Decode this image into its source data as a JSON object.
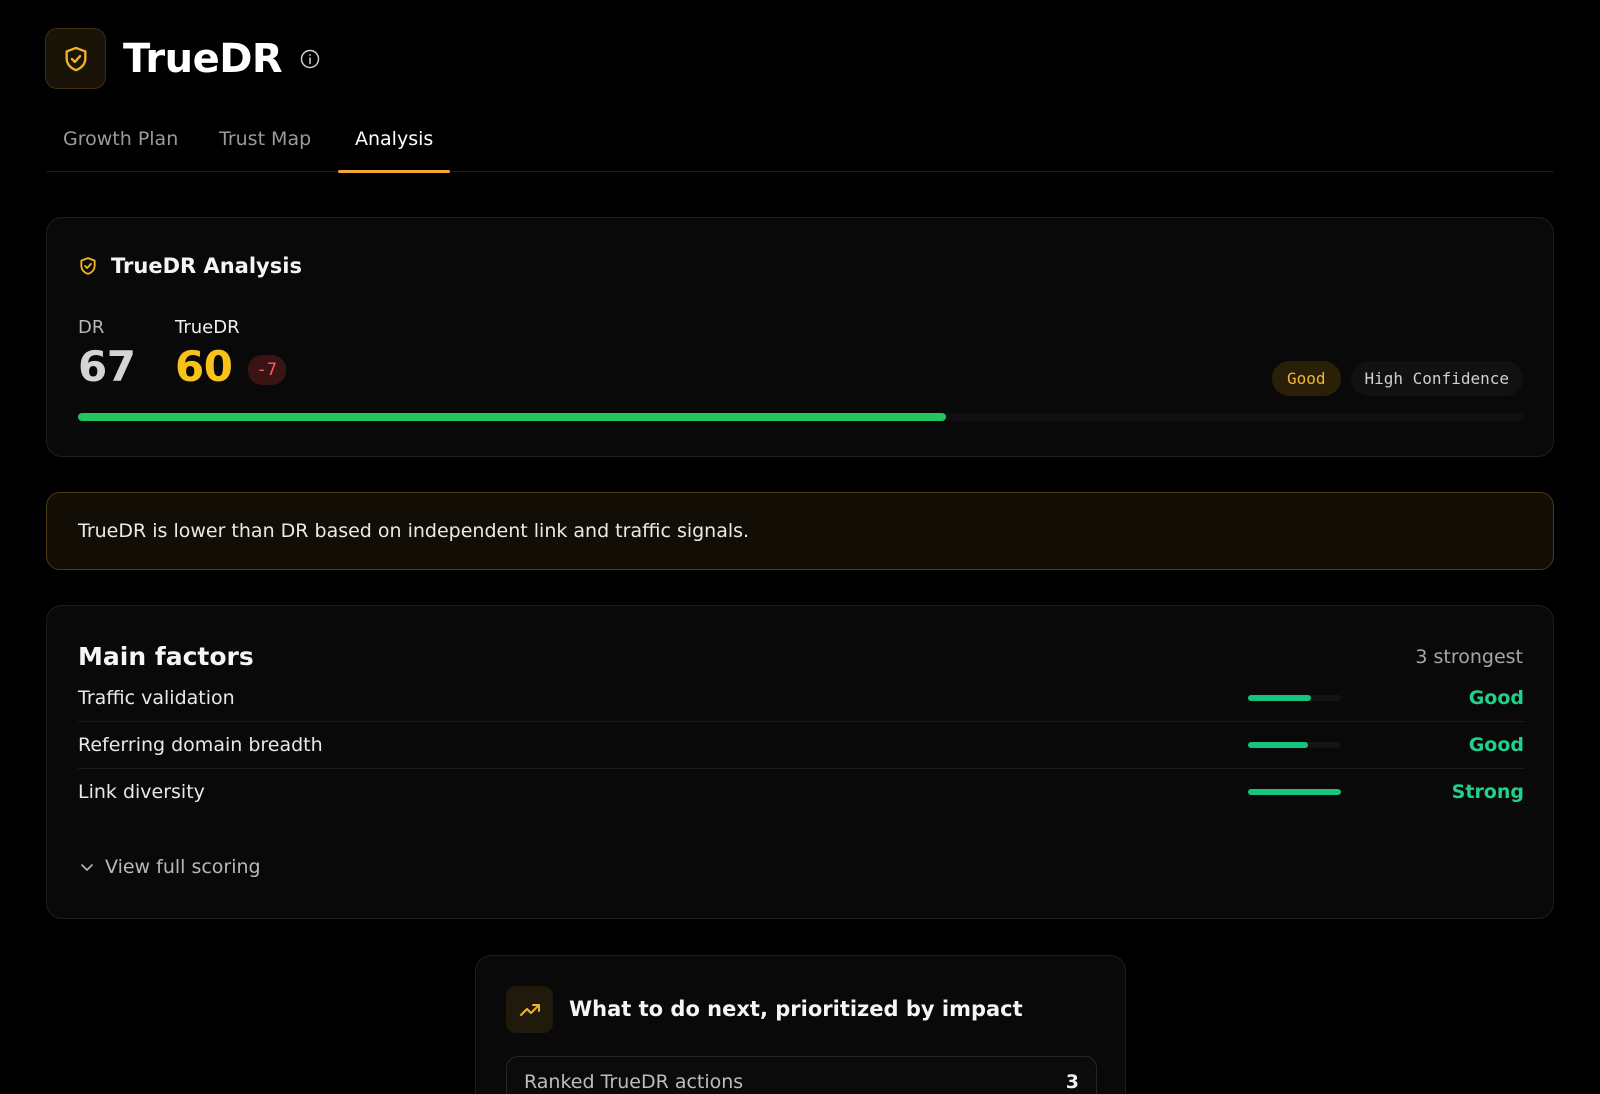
{
  "app": {
    "title": "TrueDR"
  },
  "tabs": [
    {
      "label": "Growth Plan",
      "active": false
    },
    {
      "label": "Trust Map",
      "active": false
    },
    {
      "label": "Analysis",
      "active": true
    }
  ],
  "analysis": {
    "title": "TrueDR Analysis",
    "dr_label": "DR",
    "dr_value": "67",
    "truedr_label": "TrueDR",
    "truedr_value": "60",
    "delta": "-7",
    "rating_badge": "Good",
    "confidence_badge": "High Confidence",
    "score_progress": 0.6
  },
  "notice": {
    "text": "TrueDR is lower than DR based on independent link and traffic signals."
  },
  "factors": {
    "title": "Main factors",
    "count_label": "3 strongest",
    "items": [
      {
        "name": "Traffic validation",
        "status": "Good",
        "level": 0.68
      },
      {
        "name": "Referring domain breadth",
        "status": "Good",
        "level": 0.64
      },
      {
        "name": "Link diversity",
        "status": "Strong",
        "level": 1.0
      }
    ],
    "view_full_label": "View full scoring"
  },
  "next": {
    "title": "What to do next, prioritized by impact",
    "ranked_label": "Ranked TrueDR actions",
    "ranked_count": "3"
  },
  "colors": {
    "accent": "#f0a830",
    "truedr_value": "#f7c21a",
    "progress": "#22c55e",
    "factor_good": "#1fd18a",
    "delta": "#ff5a5a"
  },
  "icons": {
    "logo": "shield-check-icon",
    "info": "info-icon",
    "analysis": "shield-check-icon",
    "view_full": "chevron-down-icon",
    "next": "trending-up-icon"
  }
}
